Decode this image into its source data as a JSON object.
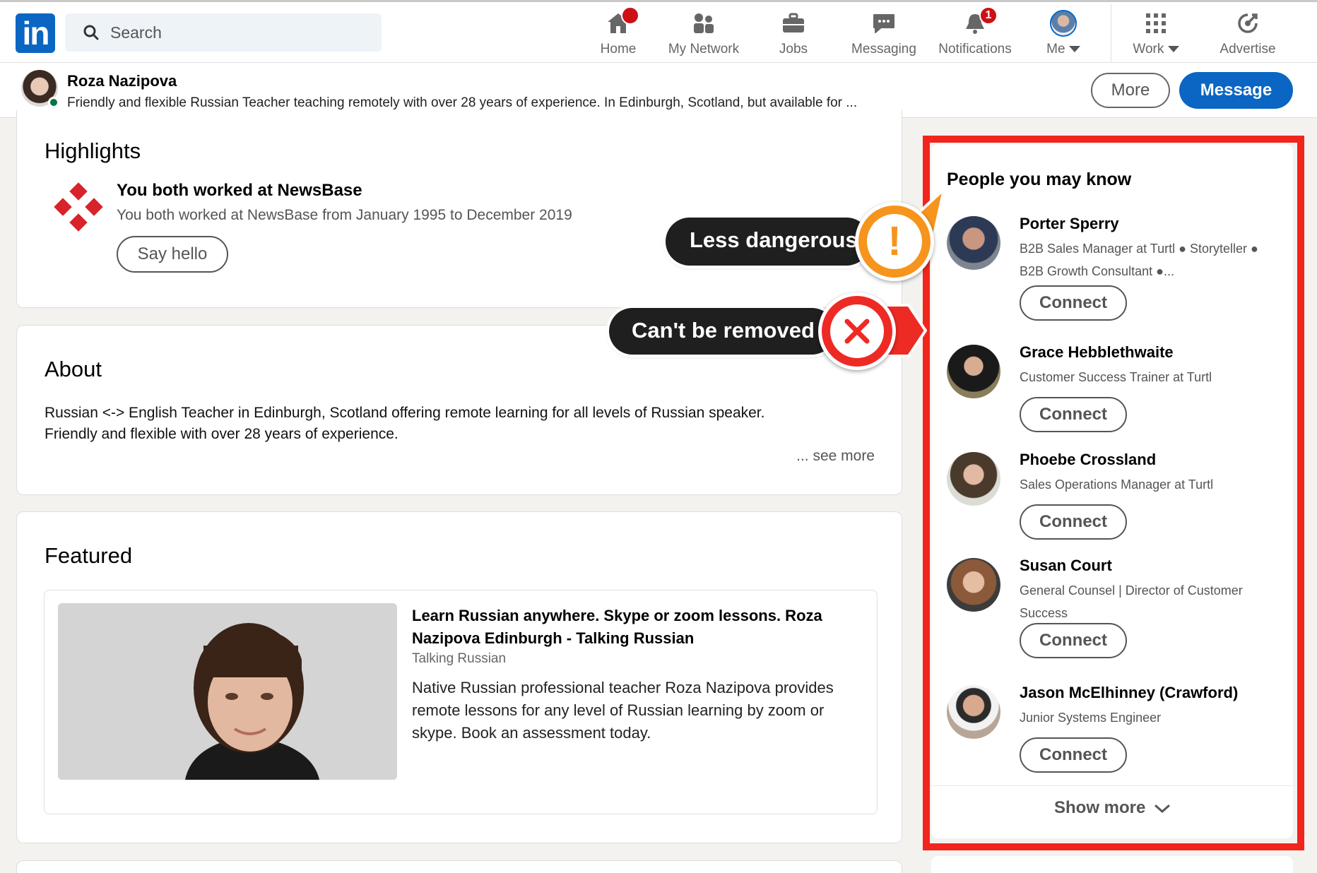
{
  "nav": {
    "search_placeholder": "Search",
    "items": [
      {
        "label": "Home",
        "icon": "home-icon",
        "badge": ""
      },
      {
        "label": "My Network",
        "icon": "network-icon",
        "badge": ""
      },
      {
        "label": "Jobs",
        "icon": "briefcase-icon",
        "badge": ""
      },
      {
        "label": "Messaging",
        "icon": "messaging-icon",
        "badge": ""
      },
      {
        "label": "Notifications",
        "icon": "bell-icon",
        "badge": "1"
      },
      {
        "label": "Me",
        "icon": "avatar",
        "badge": ""
      },
      {
        "label": "Work",
        "icon": "grid-icon",
        "badge": ""
      },
      {
        "label": "Advertise",
        "icon": "advertise-icon",
        "badge": ""
      }
    ],
    "logo_text": "in"
  },
  "profile": {
    "name": "Roza Nazipova",
    "headline": "Friendly and flexible Russian Teacher teaching remotely with over 28 years of experience. In Edinburgh, Scotland, but available for ...",
    "more_label": "More",
    "message_label": "Message"
  },
  "highlights": {
    "title": "Highlights",
    "item_title": "You both worked at NewsBase",
    "item_sub": "You both worked at NewsBase from January 1995 to December 2019",
    "button": "Say hello"
  },
  "about": {
    "title": "About",
    "line1": "Russian <-> English Teacher in Edinburgh, Scotland offering remote learning for all levels of Russian speaker.",
    "line2": "Friendly and flexible with over 28 years of experience.",
    "see_more": "... see more"
  },
  "featured": {
    "title": "Featured",
    "item_title": "Learn Russian anywhere. Skype or zoom lessons. Roza Nazipova Edinburgh - Talking Russian",
    "item_source": "Talking Russian",
    "item_desc": "Native Russian professional teacher Roza Nazipova provides remote lessons for any level of Russian learning by zoom or skype. Book an assessment today."
  },
  "pymk": {
    "title": "People you may know",
    "people": [
      {
        "name": "Porter Sperry",
        "headline": "B2B Sales Manager at Turtl ● Storyteller ● B2B Growth Consultant ●...",
        "button": "Connect"
      },
      {
        "name": "Grace Hebblethwaite",
        "headline": "Customer Success Trainer at Turtl",
        "button": "Connect"
      },
      {
        "name": "Phoebe Crossland",
        "headline": "Sales Operations Manager at Turtl",
        "button": "Connect"
      },
      {
        "name": "Susan Court",
        "headline": "General Counsel | Director of Customer Success",
        "button": "Connect"
      },
      {
        "name": "Jason McElhinney (Crawford)",
        "headline": "Junior Systems Engineer",
        "button": "Connect"
      }
    ],
    "show_more": "Show more"
  },
  "callouts": {
    "warning": "Less dangerous",
    "error": "Can't be removed"
  },
  "colors": {
    "brand": "#0a66c2",
    "highlight_frame": "#f2251d",
    "warning": "#f7941d",
    "error": "#ee2a24",
    "badge": "#cc1016"
  }
}
